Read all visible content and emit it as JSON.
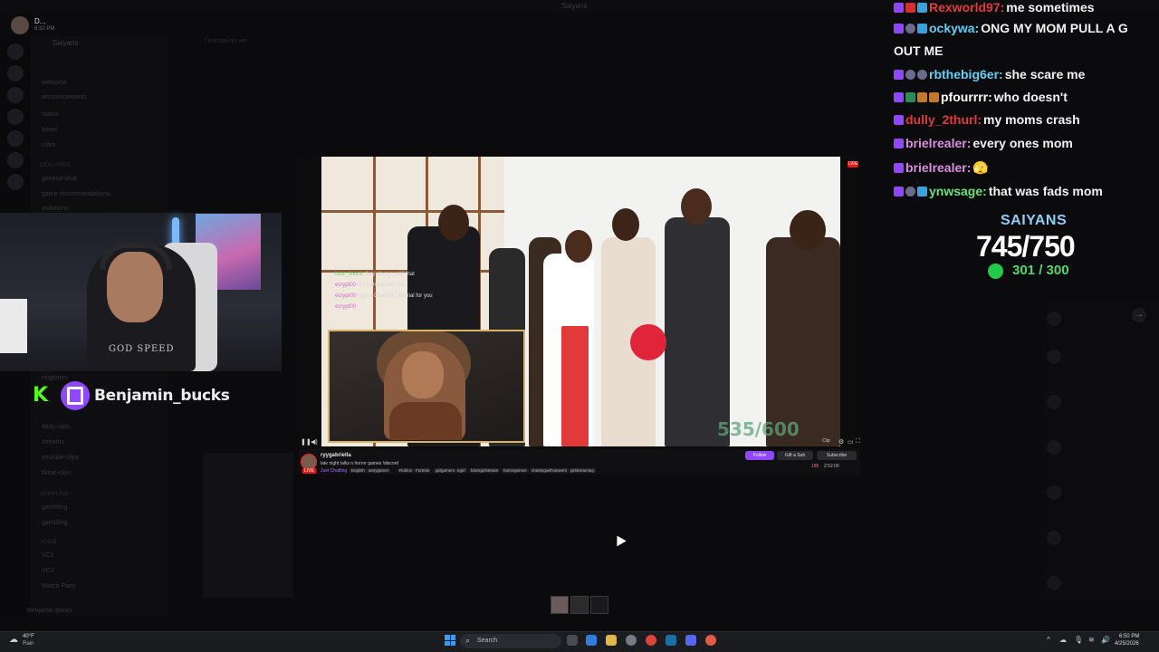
{
  "window": {
    "title": "Saiyans"
  },
  "profile": {
    "name": "D...",
    "sub": "6:32 PM"
  },
  "discord": {
    "server_name": "Saiyans",
    "channels_top": [
      "welcome",
      "announcements",
      "status",
      "boost",
      "rules"
    ],
    "category_general": "gen / free",
    "channels_general": [
      "general-chat",
      "game-recommendations",
      "invitatons"
    ],
    "channels_mid": [
      "ringtones",
      "daily-clips",
      "streams",
      "youtube-clips",
      "tiktok-clips"
    ],
    "category_gambling": "gambling",
    "channels_gambling": [
      "gambling",
      "gambling"
    ],
    "category_voice": "voice",
    "channels_voice": [
      "VC1",
      "VC2",
      "Watch Party"
    ],
    "user_bottom": "Benjamin bucks",
    "chat_header": "| mental-no-vet",
    "chat_header_sub": "Don't even listen to this you just see a link"
  },
  "overlay": {
    "streamer_name": "Benjamin_bucks",
    "webcam_shirt": "GOD SPEED"
  },
  "stream": {
    "counter": "535/600",
    "live_badge": "LIVE",
    "channel": "ryygabriella",
    "title": "late night talks n horror games !discord",
    "category": "Just Chatting",
    "tags": [
      "English",
      "aesygamer",
      "Roblox",
      "Fortnite",
      "girlgamers",
      "egirl",
      "blackgirlstream",
      "horrorgames",
      "chattingwithviewers",
      "girlstreaming"
    ],
    "follow_label": "Follow",
    "gift_label": "Gift a Sub",
    "sub_label": "Subscribe",
    "viewers": "185",
    "uptime": "2:52:09",
    "clip_label": "Clip",
    "overlay_chat": [
      {
        "user": "tock_3nor3:",
        "text": "they always add that",
        "color": "#6bd06b"
      },
      {
        "user": "ecrypt00",
        "text": "bro bombarded that",
        "color": "#d06bd0"
      },
      {
        "user": "ecrypt00",
        "text": "I got a ChatGPT tutorial for you",
        "color": "#d06bd0"
      },
      {
        "user": "ecrypt00",
        "text": "",
        "color": "#d06bd0"
      }
    ]
  },
  "chat": [
    {
      "badges": [
        "prime",
        "red",
        "box"
      ],
      "user": "Rexworld97:",
      "color": "#e03a3a",
      "text": "me sometimes"
    },
    {
      "badges": [
        "prime",
        "sub",
        "box"
      ],
      "user": "ockywa:",
      "color": "#5fd0f5",
      "text": "ONG MY MOM PULL A G"
    },
    {
      "badges": [],
      "user": "",
      "color": "#ffffff",
      "text": "OUT ME"
    },
    {
      "badges": [
        "prime",
        "sub",
        "sub"
      ],
      "user": "rbthebig6er:",
      "color": "#5fd0f5",
      "text": "she scare me"
    },
    {
      "badges": [
        "prime",
        "green",
        "gift",
        "gift"
      ],
      "user": "pfourrrr:",
      "color": "#ffffff",
      "text": "who doesn't"
    },
    {
      "badges": [
        "prime"
      ],
      "user": "dully_2thurl:",
      "color": "#e03a3a",
      "text": "my moms crash"
    },
    {
      "badges": [
        "prime"
      ],
      "user": "brielrealer:",
      "color": "#d98fe0",
      "text": "every ones mom"
    },
    {
      "badges": [
        "prime"
      ],
      "user": "brielrealer:",
      "color": "#d98fe0",
      "text": "🫣"
    },
    {
      "badges": [
        "prime",
        "sub",
        "box"
      ],
      "user": "ynwsage:",
      "color": "#6be07a",
      "text": "that was fads mom"
    }
  ],
  "goal": {
    "title": "SAIYANS",
    "main": "745/750",
    "sub": "301 / 300",
    "main_fraction": 0.9933,
    "sub_fraction": 1.0
  },
  "taskbar": {
    "weather_temp": "40°F",
    "weather_cond": "Rain",
    "search_placeholder": "Search",
    "time": "6:50 PM",
    "date": "4/25/2026"
  },
  "colors": {
    "twitch_purple": "#9146ff",
    "kick_green": "#53fc18",
    "goal_blue": "#8fcff5",
    "goal_green": "#4ed86a"
  }
}
